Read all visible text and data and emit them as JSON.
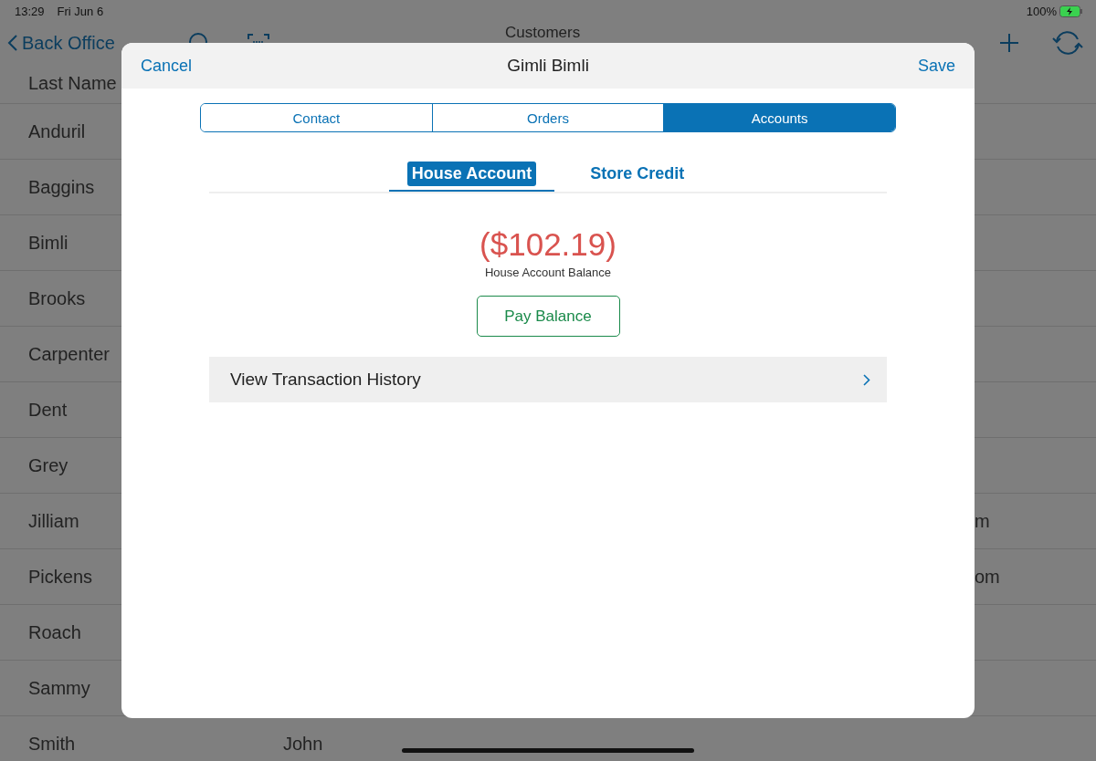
{
  "status_bar": {
    "time": "13:29",
    "date": "Fri Jun 6",
    "battery": "100%"
  },
  "nav_bar": {
    "back": "Back Office",
    "title": "Customers"
  },
  "list": {
    "header": "Last Name",
    "rows": [
      {
        "last_name": "Anduril"
      },
      {
        "last_name": "Baggins"
      },
      {
        "last_name": "Bimli"
      },
      {
        "last_name": "Brooks"
      },
      {
        "last_name": "Carpenter"
      },
      {
        "last_name": "Dent"
      },
      {
        "last_name": "Grey"
      },
      {
        "last_name": "Jilliam",
        "column_3": "m"
      },
      {
        "last_name": "Pickens",
        "column_3": "om"
      },
      {
        "last_name": "Roach"
      },
      {
        "last_name": "Sammy"
      },
      {
        "last_name": "Smith",
        "column_2": "John"
      }
    ]
  },
  "modal": {
    "cancel": "Cancel",
    "title": "Gimli Bimli",
    "save": "Save",
    "tabs": [
      {
        "label": "Contact",
        "selected": false
      },
      {
        "label": "Orders",
        "selected": false
      },
      {
        "label": "Accounts",
        "selected": true
      }
    ],
    "sub_tabs": [
      {
        "label": "House Account",
        "selected": true
      },
      {
        "label": "Store Credit",
        "selected": false
      }
    ],
    "balance": "($102.19)",
    "balance_label": "House Account Balance",
    "pay_button": "Pay Balance",
    "history_row": "View Transaction History"
  }
}
